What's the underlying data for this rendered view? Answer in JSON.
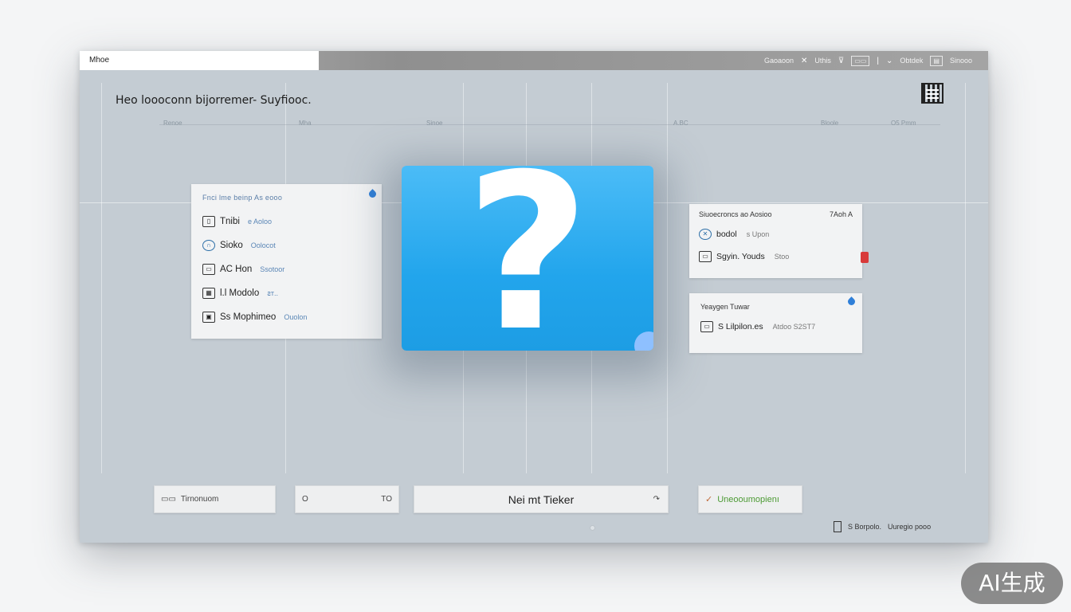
{
  "window": {
    "title": "Mhoe",
    "toolbar": {
      "item1": "Gaoaoon",
      "item2": "Uthis",
      "item3": "Obtdek",
      "item4": "Sinooo"
    }
  },
  "headline": "Heo loooconn bijorremer- Suyfiooc.",
  "timeline": [
    "Renoe",
    "Mha",
    "Sinoe",
    "A.BC",
    "Bloole",
    "O5 Pmm"
  ],
  "left_panel": {
    "title": "Fnci lme beinp As eooo",
    "items": [
      {
        "label": "Tnibi",
        "sub": "e Aoloo"
      },
      {
        "label": "Sioko",
        "sub": "Oolocot"
      },
      {
        "label": "AC Hon",
        "sub": "Ssotoor"
      },
      {
        "label": "l.l Modolo",
        "sub": "ꙅᴛ.."
      },
      {
        "label": "Ss Mophimeo",
        "sub": "Ouolon"
      }
    ]
  },
  "right_panel_1": {
    "title": "Siuoecroncs ao Aosioo",
    "title_extra": "7Aoh A",
    "items": [
      {
        "label": "bodol",
        "meta": "s Upon"
      },
      {
        "label": "Sgyin. Youds",
        "meta": "Stoo"
      }
    ]
  },
  "right_panel_2": {
    "title": "Yeaygen Tuwar",
    "items": [
      {
        "label": "S Lilpilon.es",
        "meta": "Atdoo  S2ST7"
      }
    ]
  },
  "buttons": {
    "b1": "Tirnonuom",
    "b2_left": "O",
    "b2_right": "TO",
    "b3": "Nei mt Tieker",
    "b3_arrow": "↷",
    "b4": "Uneooumopienı"
  },
  "footer": {
    "left": "S Borpolo.",
    "right": "Uuregio pooo"
  },
  "badge": "AI生成",
  "colors": {
    "accent": "#22a5ec",
    "link_blue": "#5a86b6",
    "success_green": "#4c9a34",
    "alert_red": "#d83a3a"
  }
}
